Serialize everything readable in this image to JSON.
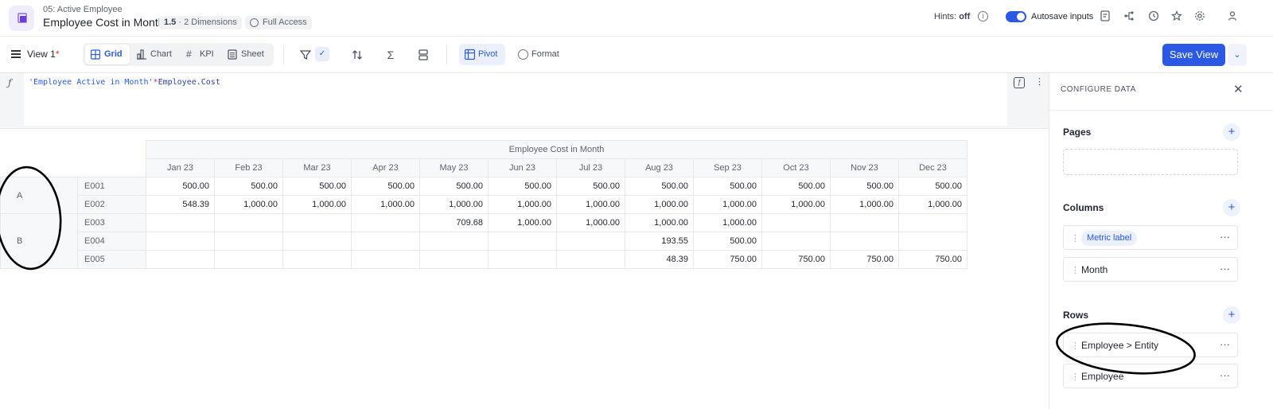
{
  "header": {
    "breadcrumb": "05: Active Employee",
    "title": "Employee Cost in Month",
    "version": "1.5",
    "dimensions": "· 2 Dimensions",
    "access": "Full Access",
    "hints_label": "Hints:",
    "hints_value": "off",
    "autosave_label": "Autosave inputs",
    "autosave_on": true
  },
  "toolbar": {
    "view_name": "View 1",
    "view_modified": "*",
    "tabs": [
      {
        "label": "Grid",
        "icon": "grid-icon",
        "active": true
      },
      {
        "label": "Chart",
        "icon": "chart-icon",
        "active": false
      },
      {
        "label": "KPI",
        "icon": "hash-icon",
        "active": false
      },
      {
        "label": "Sheet",
        "icon": "sheet-icon",
        "active": false
      }
    ],
    "pivot_label": "Pivot",
    "format_label": "Format",
    "save_label": "Save View"
  },
  "formula": {
    "part1": "'Employee Active in Month'",
    "operator": "*",
    "part2": "Employee.Cost"
  },
  "grid": {
    "metric_header": "Employee Cost in Month",
    "months": [
      "Jan 23",
      "Feb 23",
      "Mar 23",
      "Apr 23",
      "May 23",
      "Jun 23",
      "Jul 23",
      "Aug 23",
      "Sep 23",
      "Oct 23",
      "Nov 23",
      "Dec 23"
    ],
    "groups": [
      {
        "entity": "A",
        "rows": [
          {
            "employee": "E001",
            "values": [
              "500.00",
              "500.00",
              "500.00",
              "500.00",
              "500.00",
              "500.00",
              "500.00",
              "500.00",
              "500.00",
              "500.00",
              "500.00",
              "500.00"
            ]
          },
          {
            "employee": "E002",
            "values": [
              "548.39",
              "1,000.00",
              "1,000.00",
              "1,000.00",
              "1,000.00",
              "1,000.00",
              "1,000.00",
              "1,000.00",
              "1,000.00",
              "1,000.00",
              "1,000.00",
              "1,000.00"
            ]
          }
        ]
      },
      {
        "entity": "B",
        "rows": [
          {
            "employee": "E003",
            "values": [
              "",
              "",
              "",
              "",
              "709.68",
              "1,000.00",
              "1,000.00",
              "1,000.00",
              "1,000.00",
              "",
              "",
              ""
            ]
          },
          {
            "employee": "E004",
            "values": [
              "",
              "",
              "",
              "",
              "",
              "",
              "",
              "193.55",
              "500.00",
              "",
              "",
              ""
            ]
          },
          {
            "employee": "E005",
            "values": [
              "",
              "",
              "",
              "",
              "",
              "",
              "",
              "48.39",
              "750.00",
              "750.00",
              "750.00",
              "750.00"
            ]
          }
        ]
      }
    ]
  },
  "panel": {
    "title": "CONFIGURE DATA",
    "pages_title": "Pages",
    "columns_title": "Columns",
    "columns": [
      {
        "label": "Metric label",
        "tag": true
      },
      {
        "label": "Month",
        "tag": false
      }
    ],
    "rows_title": "Rows",
    "rows": [
      {
        "label": "Employee > Entity"
      },
      {
        "label": "Employee"
      }
    ]
  }
}
